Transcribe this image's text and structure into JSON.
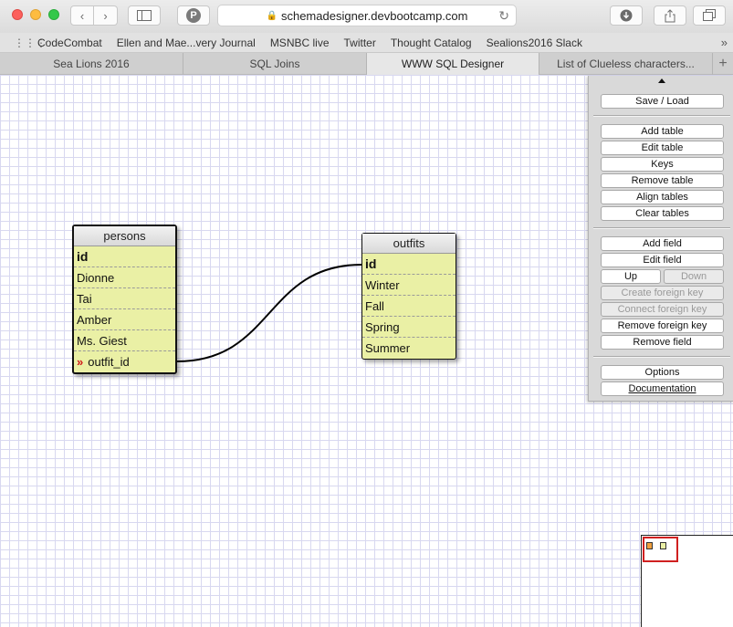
{
  "browser": {
    "url": "schemadesigner.devbootcamp.com",
    "bookmarks": [
      "CodeCombat",
      "Ellen and Mae...very Journal",
      "MSNBC live",
      "Twitter",
      "Thought Catalog",
      "Sealions2016 Slack"
    ],
    "tabs": [
      {
        "label": "Sea Lions 2016",
        "active": false
      },
      {
        "label": "SQL Joins",
        "active": false
      },
      {
        "label": "WWW SQL Designer",
        "active": true
      },
      {
        "label": "List of Clueless characters...",
        "active": false
      }
    ]
  },
  "tables": {
    "persons": {
      "title": "persons",
      "rows": [
        "id",
        "Dionne",
        "Tai",
        "Amber",
        "Ms. Giest",
        "outfit_id"
      ]
    },
    "outfits": {
      "title": "outfits",
      "rows": [
        "id",
        "Winter",
        "Fall",
        "Spring",
        "Summer"
      ]
    }
  },
  "panel": {
    "save_load": "Save / Load",
    "add_table": "Add table",
    "edit_table": "Edit table",
    "keys": "Keys",
    "remove_table": "Remove table",
    "align_tables": "Align tables",
    "clear_tables": "Clear tables",
    "add_field": "Add field",
    "edit_field": "Edit field",
    "up": "Up",
    "down": "Down",
    "create_fk": "Create foreign key",
    "connect_fk": "Connect foreign key",
    "remove_fk": "Remove foreign key",
    "remove_field": "Remove field",
    "options": "Options",
    "documentation": "Documentation"
  },
  "colors": {
    "table_fill": "#eaf0a5",
    "fk_marker": "#d01818",
    "minimap_view": "#d02020"
  }
}
